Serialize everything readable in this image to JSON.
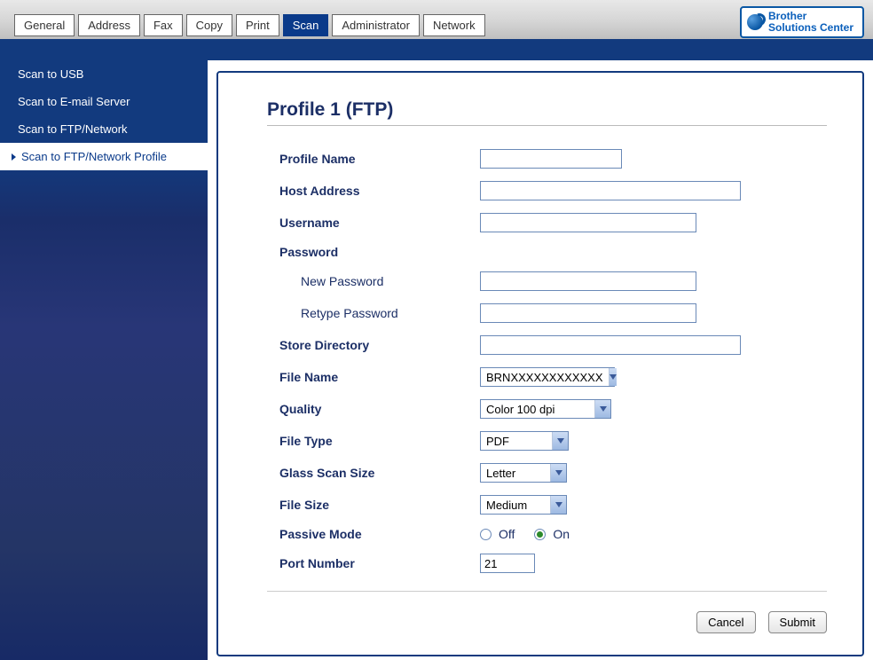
{
  "tabs": {
    "general": "General",
    "address": "Address",
    "fax": "Fax",
    "copy": "Copy",
    "print": "Print",
    "scan": "Scan",
    "administrator": "Administrator",
    "network": "Network",
    "active": "scan"
  },
  "solutions_center": {
    "line1": "Brother",
    "line2": "Solutions Center"
  },
  "sidebar": {
    "items": [
      {
        "key": "usb",
        "label": "Scan to USB"
      },
      {
        "key": "email",
        "label": "Scan to E-mail Server"
      },
      {
        "key": "ftpnet",
        "label": "Scan to FTP/Network"
      },
      {
        "key": "profile",
        "label": "Scan to FTP/Network Profile"
      }
    ],
    "selected": "profile"
  },
  "page": {
    "title": "Profile 1 (FTP)"
  },
  "form": {
    "profile_name": {
      "label": "Profile Name",
      "value": ""
    },
    "host_address": {
      "label": "Host Address",
      "value": ""
    },
    "username": {
      "label": "Username",
      "value": ""
    },
    "password_section": "Password",
    "new_password": {
      "label": "New Password",
      "value": ""
    },
    "retype_password": {
      "label": "Retype Password",
      "value": ""
    },
    "store_directory": {
      "label": "Store Directory",
      "value": ""
    },
    "file_name": {
      "label": "File Name",
      "value": "BRNXXXXXXXXXXXX"
    },
    "quality": {
      "label": "Quality",
      "value": "Color 100 dpi"
    },
    "file_type": {
      "label": "File Type",
      "value": "PDF"
    },
    "glass_scan_size": {
      "label": "Glass Scan Size",
      "value": "Letter"
    },
    "file_size": {
      "label": "File Size",
      "value": "Medium"
    },
    "passive_mode": {
      "label": "Passive Mode",
      "off": "Off",
      "on": "On",
      "value": "On"
    },
    "port_number": {
      "label": "Port Number",
      "value": "21"
    }
  },
  "buttons": {
    "cancel": "Cancel",
    "submit": "Submit"
  }
}
